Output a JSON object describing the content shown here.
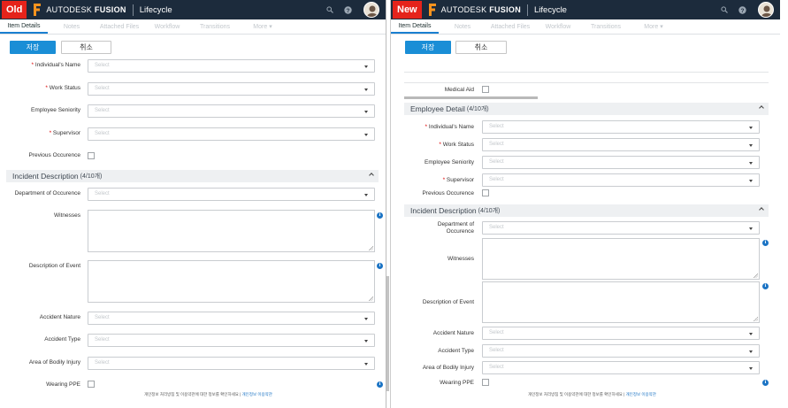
{
  "common": {
    "brand_name": "AUTODESK",
    "brand_product": "FUSION",
    "app_title": "Lifecycle",
    "tabs": [
      "Item Details",
      "Notes",
      "Attached Files",
      "Workflow",
      "Transitions",
      "More"
    ],
    "save_label": "저장",
    "cancel_label": "취소",
    "select_placeholder": "Select",
    "info_icon": "i",
    "accent_color": "#1a8ed6",
    "badge_color": "#e5231b",
    "header_color": "#1c2b3c"
  },
  "old": {
    "badge": "Old",
    "fields": {
      "individuals_name": "Individual's Name",
      "work_status": "Work Status",
      "employee_seniority": "Employee Seniority",
      "supervisor": "Supervisor",
      "previous_occurence": "Previous Occurence",
      "department_of_occurence": "Department of Occurence",
      "witnesses": "Witnesses",
      "description_of_event": "Description of Event",
      "accident_nature": "Accident Nature",
      "accident_type": "Accident Type",
      "area_of_bodily_injury": "Area of Bodily Injury",
      "wearing_ppe": "Wearing PPE"
    },
    "incident_section": {
      "title": "Incident Description",
      "count": "(4/10개)"
    },
    "footer": {
      "text": "개인정보 처리방침 및 이용약관에 대한 정보를 확인하세요 |",
      "link1": "개인정보",
      "link2": "이용약관"
    }
  },
  "new": {
    "badge": "New",
    "medical_aid": "Medical Aid",
    "employee_section": {
      "title": "Employee Detail",
      "count": "(4/10개)"
    },
    "fields": {
      "individuals_name": "Individual's Name",
      "work_status": "Work Status",
      "employee_seniority": "Employee Seniority",
      "supervisor": "Supervisor",
      "previous_occurence": "Previous Occurence",
      "department_line1": "Department of",
      "department_line2": "Occurence",
      "witnesses": "Witnesses",
      "description_of_event": "Description of Event",
      "accident_nature": "Accident Nature",
      "accident_type": "Accident Type",
      "area_of_bodily_injury": "Area of Bodily Injury",
      "wearing_ppe": "Wearing PPE"
    },
    "incident_section": {
      "title": "Incident Description",
      "count": "(4/10개)"
    },
    "footer": {
      "text": "개인정보 처리방침 및 이용약관에 대한 정보를 확인하세요 |",
      "link1": "개인정보",
      "link2": "이용약관"
    }
  }
}
